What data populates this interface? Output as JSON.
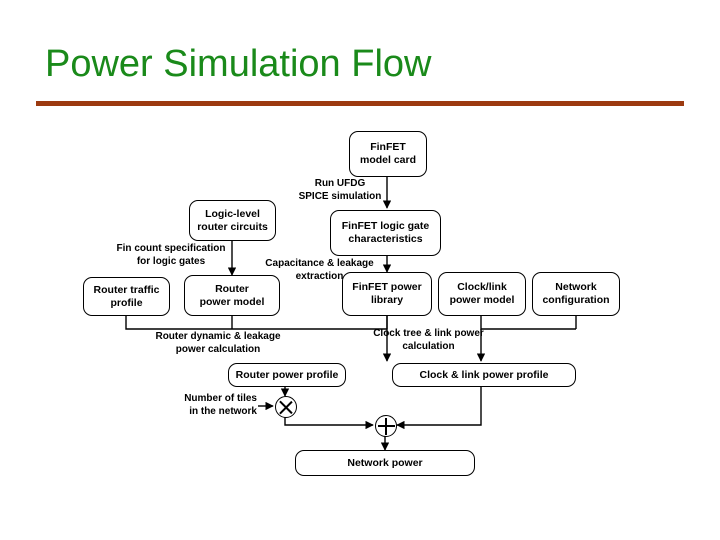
{
  "slide": {
    "title": "Power Simulation Flow",
    "accent_title_color": "#1a8a1a",
    "accent_rule_color": "#9c3a10"
  },
  "diagram": {
    "nodes": [
      {
        "id": "finfet-model-card",
        "label": "FinFET\nmodel card"
      },
      {
        "id": "logic-level-router-circuits",
        "label": "Logic-level\nrouter circuits"
      },
      {
        "id": "finfet-logic-gate-characteristics",
        "label": "FinFET logic gate\ncharacteristics"
      },
      {
        "id": "router-traffic-profile",
        "label": "Router traffic\nprofile"
      },
      {
        "id": "router-power-model",
        "label": "Router\npower model"
      },
      {
        "id": "finfet-power-library",
        "label": "FinFET power\nlibrary"
      },
      {
        "id": "clock-link-power-model",
        "label": "Clock/link\npower model"
      },
      {
        "id": "network-configuration",
        "label": "Network\nconfiguration"
      },
      {
        "id": "router-power-profile",
        "label": "Router power profile"
      },
      {
        "id": "clock-link-power-profile",
        "label": "Clock & link power profile"
      },
      {
        "id": "network-power",
        "label": "Network power"
      }
    ],
    "edge_labels": [
      {
        "id": "run-ufdg-spice-simulation",
        "label": "Run UFDG\nSPICE simulation"
      },
      {
        "id": "fin-count-specification",
        "label": "Fin count specification\nfor logic gates"
      },
      {
        "id": "capacitance-leakage-extraction",
        "label": "Capacitance & leakage\nextraction"
      },
      {
        "id": "router-dynamic-leakage-power-calculation",
        "label": "Router dynamic & leakage\npower calculation"
      },
      {
        "id": "clock-tree-link-power-calculation",
        "label": "Clock tree & link power\ncalculation"
      },
      {
        "id": "number-of-tiles",
        "label": "Number of tiles\nin the network"
      }
    ],
    "operators": [
      {
        "id": "multiply-node",
        "symbol": "x"
      },
      {
        "id": "sum-node",
        "symbol": "+"
      }
    ]
  }
}
